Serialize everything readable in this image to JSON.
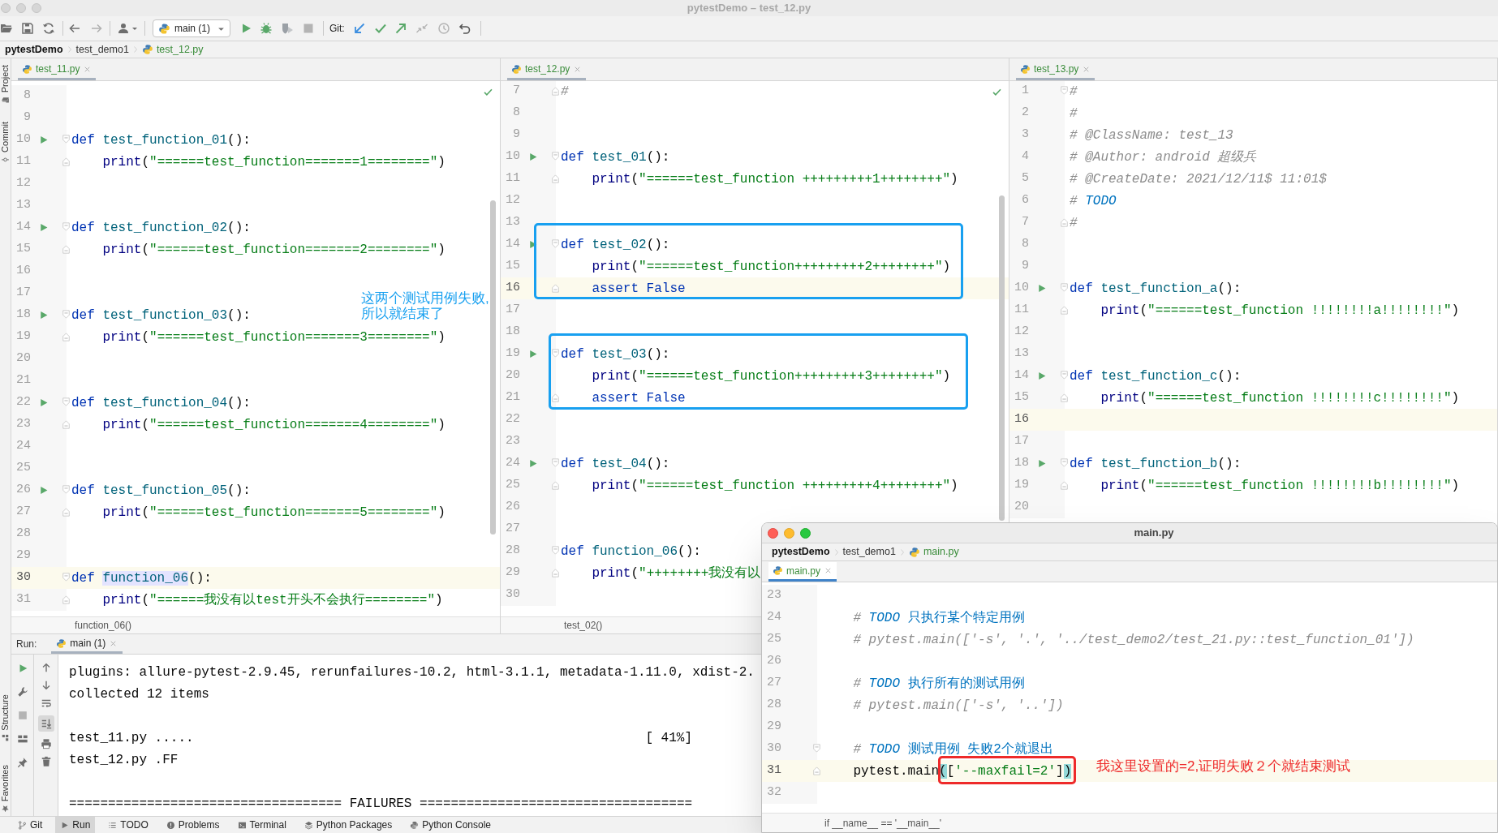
{
  "window": {
    "title": "pytestDemo – test_12.py"
  },
  "toolbar": {
    "run_config": "main (1)",
    "vcs_label": "Git:"
  },
  "breadcrumb": [
    "pytestDemo",
    "test_demo1",
    "test_12.py"
  ],
  "tool_window_tabs": {
    "top": [
      "Project",
      "Commit"
    ],
    "bottom": [
      "Structure",
      "Favorites"
    ]
  },
  "editors": [
    {
      "tab": "test_11.py",
      "context": "function_06()",
      "inspection_ok": true,
      "scrollbar": true,
      "lines": [
        {
          "number": "8",
          "kind": "plain",
          "run": false,
          "current": false
        },
        {
          "number": "9",
          "kind": "plain",
          "run": false,
          "current": false
        },
        {
          "number": "10",
          "kind": "fold-start",
          "run": true,
          "current": false,
          "code": [
            {
              "text": "def ",
              "kind": "kw"
            },
            {
              "text": "test_function_01",
              "kind": "fn"
            },
            {
              "text": "():",
              "kind": "punc"
            }
          ]
        },
        {
          "number": "11",
          "kind": "fold-end",
          "run": false,
          "current": false,
          "code": [
            {
              "text": "    print",
              "kind": "builtin"
            },
            {
              "text": "(",
              "kind": "punc"
            },
            {
              "text": "\"======test_function=======1========\"",
              "kind": "str"
            },
            {
              "text": ")",
              "kind": "punc"
            }
          ]
        },
        {
          "number": "12",
          "kind": "plain",
          "run": false,
          "current": false
        },
        {
          "number": "13",
          "kind": "plain",
          "run": false,
          "current": false
        },
        {
          "number": "14",
          "kind": "fold-start",
          "run": true,
          "current": false,
          "code": [
            {
              "text": "def ",
              "kind": "kw"
            },
            {
              "text": "test_function_02",
              "kind": "fn"
            },
            {
              "text": "():",
              "kind": "punc"
            }
          ]
        },
        {
          "number": "15",
          "kind": "fold-end",
          "run": false,
          "current": false,
          "code": [
            {
              "text": "    print",
              "kind": "builtin"
            },
            {
              "text": "(",
              "kind": "punc"
            },
            {
              "text": "\"======test_function=======2========\"",
              "kind": "str"
            },
            {
              "text": ")",
              "kind": "punc"
            }
          ]
        },
        {
          "number": "16",
          "kind": "plain",
          "run": false,
          "current": false
        },
        {
          "number": "17",
          "kind": "plain",
          "run": false,
          "current": false
        },
        {
          "number": "18",
          "kind": "fold-start",
          "run": true,
          "current": false,
          "code": [
            {
              "text": "def ",
              "kind": "kw"
            },
            {
              "text": "test_function_03",
              "kind": "fn"
            },
            {
              "text": "():",
              "kind": "punc"
            }
          ]
        },
        {
          "number": "19",
          "kind": "fold-end",
          "run": false,
          "current": false,
          "code": [
            {
              "text": "    print",
              "kind": "builtin"
            },
            {
              "text": "(",
              "kind": "punc"
            },
            {
              "text": "\"======test_function=======3========\"",
              "kind": "str"
            },
            {
              "text": ")",
              "kind": "punc"
            }
          ]
        },
        {
          "number": "20",
          "kind": "plain",
          "run": false,
          "current": false
        },
        {
          "number": "21",
          "kind": "plain",
          "run": false,
          "current": false
        },
        {
          "number": "22",
          "kind": "fold-start",
          "run": true,
          "current": false,
          "code": [
            {
              "text": "def ",
              "kind": "kw"
            },
            {
              "text": "test_function_04",
              "kind": "fn"
            },
            {
              "text": "():",
              "kind": "punc"
            }
          ]
        },
        {
          "number": "23",
          "kind": "fold-end",
          "run": false,
          "current": false,
          "code": [
            {
              "text": "    print",
              "kind": "builtin"
            },
            {
              "text": "(",
              "kind": "punc"
            },
            {
              "text": "\"======test_function=======4========\"",
              "kind": "str"
            },
            {
              "text": ")",
              "kind": "punc"
            }
          ]
        },
        {
          "number": "24",
          "kind": "plain",
          "run": false,
          "current": false
        },
        {
          "number": "25",
          "kind": "plain",
          "run": false,
          "current": false
        },
        {
          "number": "26",
          "kind": "fold-start",
          "run": true,
          "current": false,
          "code": [
            {
              "text": "def ",
              "kind": "kw"
            },
            {
              "text": "test_function_05",
              "kind": "fn"
            },
            {
              "text": "():",
              "kind": "punc"
            }
          ]
        },
        {
          "number": "27",
          "kind": "fold-end",
          "run": false,
          "current": false,
          "code": [
            {
              "text": "    print",
              "kind": "builtin"
            },
            {
              "text": "(",
              "kind": "punc"
            },
            {
              "text": "\"======test_function=======5========\"",
              "kind": "str"
            },
            {
              "text": ")",
              "kind": "punc"
            }
          ]
        },
        {
          "number": "28",
          "kind": "plain",
          "run": false,
          "current": false
        },
        {
          "number": "29",
          "kind": "plain",
          "run": false,
          "current": false
        },
        {
          "number": "30",
          "kind": "fold-start",
          "run": false,
          "current": true,
          "code": [
            {
              "text": "def ",
              "kind": "kw"
            },
            {
              "text": "function_06",
              "kind": "fnhl"
            },
            {
              "text": "():",
              "kind": "punc"
            }
          ]
        },
        {
          "number": "31",
          "kind": "fold-end",
          "run": false,
          "current": false,
          "code": [
            {
              "text": "    print",
              "kind": "builtin"
            },
            {
              "text": "(",
              "kind": "punc"
            },
            {
              "text": "\"======我没有以test开头不会执行========\"",
              "kind": "str"
            },
            {
              "text": ")",
              "kind": "punc"
            }
          ]
        }
      ]
    },
    {
      "tab": "test_12.py",
      "context": "test_02()",
      "inspection_ok": true,
      "scrollbar": true,
      "lines": [
        {
          "number": "7",
          "kind": "fold-end",
          "run": false,
          "current": false,
          "code": [
            {
              "text": "#",
              "kind": "comment"
            }
          ]
        },
        {
          "number": "8",
          "kind": "plain",
          "run": false,
          "current": false
        },
        {
          "number": "9",
          "kind": "plain",
          "run": false,
          "current": false
        },
        {
          "number": "10",
          "kind": "fold-start",
          "run": true,
          "current": false,
          "code": [
            {
              "text": "def ",
              "kind": "kw"
            },
            {
              "text": "test_01",
              "kind": "fn"
            },
            {
              "text": "():",
              "kind": "punc"
            }
          ]
        },
        {
          "number": "11",
          "kind": "fold-end",
          "run": false,
          "current": false,
          "code": [
            {
              "text": "    print",
              "kind": "builtin"
            },
            {
              "text": "(",
              "kind": "punc"
            },
            {
              "text": "\"======test_function +++++++++1++++++++\"",
              "kind": "str"
            },
            {
              "text": ")",
              "kind": "punc"
            }
          ]
        },
        {
          "number": "12",
          "kind": "plain",
          "run": false,
          "current": false
        },
        {
          "number": "13",
          "kind": "plain",
          "run": false,
          "current": false
        },
        {
          "number": "14",
          "kind": "fold-start",
          "run": true,
          "current": false,
          "code": [
            {
              "text": "def ",
              "kind": "kw"
            },
            {
              "text": "test_02",
              "kind": "fn"
            },
            {
              "text": "():",
              "kind": "punc"
            }
          ]
        },
        {
          "number": "15",
          "kind": "plain",
          "run": false,
          "current": false,
          "code": [
            {
              "text": "    print",
              "kind": "builtin"
            },
            {
              "text": "(",
              "kind": "punc"
            },
            {
              "text": "\"======test_function+++++++++2++++++++\"",
              "kind": "str"
            },
            {
              "text": ")",
              "kind": "punc"
            }
          ]
        },
        {
          "number": "16",
          "kind": "fold-end",
          "run": false,
          "current": true,
          "code": [
            {
              "text": "    assert False",
              "kind": "kw"
            }
          ]
        },
        {
          "number": "17",
          "kind": "plain",
          "run": false,
          "current": false
        },
        {
          "number": "18",
          "kind": "plain",
          "run": false,
          "current": false
        },
        {
          "number": "19",
          "kind": "fold-start",
          "run": true,
          "current": false,
          "code": [
            {
              "text": "def ",
              "kind": "kw"
            },
            {
              "text": "test_03",
              "kind": "fn"
            },
            {
              "text": "():",
              "kind": "punc"
            }
          ]
        },
        {
          "number": "20",
          "kind": "plain",
          "run": false,
          "current": false,
          "code": [
            {
              "text": "    print",
              "kind": "builtin"
            },
            {
              "text": "(",
              "kind": "punc"
            },
            {
              "text": "\"======test_function+++++++++3++++++++\"",
              "kind": "str"
            },
            {
              "text": ")",
              "kind": "punc"
            }
          ]
        },
        {
          "number": "21",
          "kind": "fold-end",
          "run": false,
          "current": false,
          "code": [
            {
              "text": "    assert False",
              "kind": "kw"
            }
          ]
        },
        {
          "number": "22",
          "kind": "plain",
          "run": false,
          "current": false
        },
        {
          "number": "23",
          "kind": "plain",
          "run": false,
          "current": false
        },
        {
          "number": "24",
          "kind": "fold-start",
          "run": true,
          "current": false,
          "code": [
            {
              "text": "def ",
              "kind": "kw"
            },
            {
              "text": "test_04",
              "kind": "fn"
            },
            {
              "text": "():",
              "kind": "punc"
            }
          ]
        },
        {
          "number": "25",
          "kind": "fold-end",
          "run": false,
          "current": false,
          "code": [
            {
              "text": "    print",
              "kind": "builtin"
            },
            {
              "text": "(",
              "kind": "punc"
            },
            {
              "text": "\"======test_function +++++++++4++++++++\"",
              "kind": "str"
            },
            {
              "text": ")",
              "kind": "punc"
            }
          ]
        },
        {
          "number": "26",
          "kind": "plain",
          "run": false,
          "current": false
        },
        {
          "number": "27",
          "kind": "plain",
          "run": false,
          "current": false
        },
        {
          "number": "28",
          "kind": "fold-start",
          "run": false,
          "current": false,
          "code": [
            {
              "text": "def ",
              "kind": "kw"
            },
            {
              "text": "function_06",
              "kind": "fn"
            },
            {
              "text": "():",
              "kind": "punc"
            }
          ]
        },
        {
          "number": "29",
          "kind": "fold-end",
          "run": false,
          "current": false,
          "code": [
            {
              "text": "    print",
              "kind": "builtin"
            },
            {
              "text": "(",
              "kind": "punc"
            },
            {
              "text": "\"++++++++我没有以",
              "kind": "str"
            }
          ]
        },
        {
          "number": "30",
          "kind": "plain",
          "run": false,
          "current": false
        }
      ]
    },
    {
      "tab": "test_13.py",
      "inspection_ok": false,
      "scrollbar": false,
      "lines": [
        {
          "number": "1",
          "kind": "fold-start",
          "run": false,
          "current": false,
          "code": [
            {
              "text": "#",
              "kind": "comment"
            }
          ]
        },
        {
          "number": "2",
          "kind": "plain",
          "run": false,
          "current": false,
          "code": [
            {
              "text": "#",
              "kind": "comment"
            }
          ]
        },
        {
          "number": "3",
          "kind": "plain",
          "run": false,
          "current": false,
          "code": [
            {
              "text": "# @ClassName: test_13",
              "kind": "comment"
            }
          ]
        },
        {
          "number": "4",
          "kind": "plain",
          "run": false,
          "current": false,
          "code": [
            {
              "text": "# @Author: android 超级兵",
              "kind": "comment"
            }
          ]
        },
        {
          "number": "5",
          "kind": "plain",
          "run": false,
          "current": false,
          "code": [
            {
              "text": "# @CreateDate: 2021/12/11$ 11:01$",
              "kind": "comment"
            }
          ]
        },
        {
          "number": "6",
          "kind": "plain",
          "run": false,
          "current": false,
          "code": [
            {
              "text": "# ",
              "kind": "comment"
            },
            {
              "text": "TODO",
              "kind": "todo"
            }
          ]
        },
        {
          "number": "7",
          "kind": "fold-end",
          "run": false,
          "current": false,
          "code": [
            {
              "text": "#",
              "kind": "comment"
            }
          ]
        },
        {
          "number": "8",
          "kind": "plain",
          "run": false,
          "current": false
        },
        {
          "number": "9",
          "kind": "plain",
          "run": false,
          "current": false
        },
        {
          "number": "10",
          "kind": "fold-start",
          "run": true,
          "current": false,
          "code": [
            {
              "text": "def ",
              "kind": "kw"
            },
            {
              "text": "test_function_a",
              "kind": "fn"
            },
            {
              "text": "():",
              "kind": "punc"
            }
          ]
        },
        {
          "number": "11",
          "kind": "fold-end",
          "run": false,
          "current": false,
          "code": [
            {
              "text": "    print",
              "kind": "builtin"
            },
            {
              "text": "(",
              "kind": "punc"
            },
            {
              "text": "\"======test_function !!!!!!!!a!!!!!!!!\"",
              "kind": "str"
            },
            {
              "text": ")",
              "kind": "punc"
            }
          ]
        },
        {
          "number": "12",
          "kind": "plain",
          "run": false,
          "current": false
        },
        {
          "number": "13",
          "kind": "plain",
          "run": false,
          "current": false
        },
        {
          "number": "14",
          "kind": "fold-start",
          "run": true,
          "current": false,
          "code": [
            {
              "text": "def ",
              "kind": "kw"
            },
            {
              "text": "test_function_c",
              "kind": "fn"
            },
            {
              "text": "():",
              "kind": "punc"
            }
          ]
        },
        {
          "number": "15",
          "kind": "fold-end",
          "run": false,
          "current": false,
          "code": [
            {
              "text": "    print",
              "kind": "builtin"
            },
            {
              "text": "(",
              "kind": "punc"
            },
            {
              "text": "\"======test_function !!!!!!!!c!!!!!!!!\"",
              "kind": "str"
            },
            {
              "text": ")",
              "kind": "punc"
            }
          ]
        },
        {
          "number": "16",
          "kind": "plain",
          "run": false,
          "current": true
        },
        {
          "number": "17",
          "kind": "plain",
          "run": false,
          "current": false
        },
        {
          "number": "18",
          "kind": "fold-start",
          "run": true,
          "current": false,
          "code": [
            {
              "text": "def ",
              "kind": "kw"
            },
            {
              "text": "test_function_b",
              "kind": "fn"
            },
            {
              "text": "():",
              "kind": "punc"
            }
          ]
        },
        {
          "number": "19",
          "kind": "fold-end",
          "run": false,
          "current": false,
          "code": [
            {
              "text": "    print",
              "kind": "builtin"
            },
            {
              "text": "(",
              "kind": "punc"
            },
            {
              "text": "\"======test_function !!!!!!!!b!!!!!!!!\"",
              "kind": "str"
            },
            {
              "text": ")",
              "kind": "punc"
            }
          ]
        },
        {
          "number": "20",
          "kind": "plain",
          "run": false,
          "current": false
        }
      ]
    }
  ],
  "run_panel": {
    "label": "Run:",
    "tab": "main (1)",
    "scroll_to_end": true,
    "output": [
      {
        "lines": [
          {
            "text": "plugins: allure-pytest-2.9.45, rerunfailures-10.2, html-3.1.1, metadata-1.11.0, xdist-2."
          },
          {
            "text": "collected 12 items"
          }
        ]
      },
      {
        "lines": [
          {
            "text": "test_11.py .....",
            "progress": "[ 41%]"
          },
          {
            "text": "test_12.py .FF"
          }
        ]
      },
      {
        "lines": [
          {
            "text": "=================================== FAILURES ==================================="
          }
        ]
      }
    ]
  },
  "bottom_tools": [
    {
      "label": "Git",
      "selected": false
    },
    {
      "label": "Run",
      "selected": true
    },
    {
      "label": "TODO",
      "selected": false
    },
    {
      "label": "Problems",
      "selected": false
    },
    {
      "label": "Terminal",
      "selected": false
    },
    {
      "label": "Python Packages",
      "selected": false
    },
    {
      "label": "Python Console",
      "selected": false
    }
  ],
  "main_window": {
    "title": "main.py",
    "breadcrumb": [
      "pytestDemo",
      "test_demo1",
      "main.py"
    ],
    "tab": "main.py",
    "context": "if __name__ == '__main__'",
    "lines": [
      {
        "number": "23",
        "kind": "plain",
        "run": false,
        "current": false
      },
      {
        "number": "24",
        "kind": "plain",
        "run": false,
        "current": false,
        "code": [
          {
            "text": "    # ",
            "kind": "comment"
          },
          {
            "text": "TODO",
            "kind": "todo"
          },
          {
            "text": " 只执行某个特定用例",
            "kind": "todotext"
          }
        ]
      },
      {
        "number": "25",
        "kind": "plain",
        "run": false,
        "current": false,
        "code": [
          {
            "text": "    # pytest.main(['-s', '.', '../test_demo2/test_21.py::test_function_01'])",
            "kind": "comment"
          }
        ]
      },
      {
        "number": "26",
        "kind": "plain",
        "run": false,
        "current": false
      },
      {
        "number": "27",
        "kind": "plain",
        "run": false,
        "current": false,
        "code": [
          {
            "text": "    # ",
            "kind": "comment"
          },
          {
            "text": "TODO",
            "kind": "todo"
          },
          {
            "text": " 执行所有的测试用例",
            "kind": "todotext"
          }
        ]
      },
      {
        "number": "28",
        "kind": "plain",
        "run": false,
        "current": false,
        "code": [
          {
            "text": "    # pytest.main(['-s', '..'])",
            "kind": "comment"
          }
        ]
      },
      {
        "number": "29",
        "kind": "plain",
        "run": false,
        "current": false
      },
      {
        "number": "30",
        "kind": "fold-start",
        "run": false,
        "current": false,
        "code": [
          {
            "text": "    # ",
            "kind": "comment"
          },
          {
            "text": "TODO",
            "kind": "todo"
          },
          {
            "text": " 测试用例 失败2个就退出",
            "kind": "todotext"
          }
        ]
      },
      {
        "number": "31",
        "kind": "fold-end",
        "run": false,
        "current": true,
        "code": [
          {
            "text": "    pytest.main",
            "kind": "plain"
          },
          {
            "text": "(",
            "kind": "brace"
          },
          {
            "text": "[",
            "kind": "punc"
          },
          {
            "text": "'--maxfail=2'",
            "kind": "str"
          },
          {
            "text": "]",
            "kind": "punc"
          },
          {
            "text": ")",
            "kind": "brace"
          }
        ]
      },
      {
        "number": "32",
        "kind": "plain",
        "run": false,
        "current": false
      }
    ]
  },
  "annotation_frames": [
    {
      "color": "#18a0f0"
    },
    {
      "color": "#18a0f0"
    },
    {
      "color": "#ee2a2a"
    }
  ],
  "annotations": [
    {
      "text": "这两个测试用例失败,\n所以就结束了",
      "color": "#18a0f0"
    },
    {
      "text": "我这里设置的=2,证明失败２个就结束测试",
      "color": "#ee2a2a"
    }
  ]
}
